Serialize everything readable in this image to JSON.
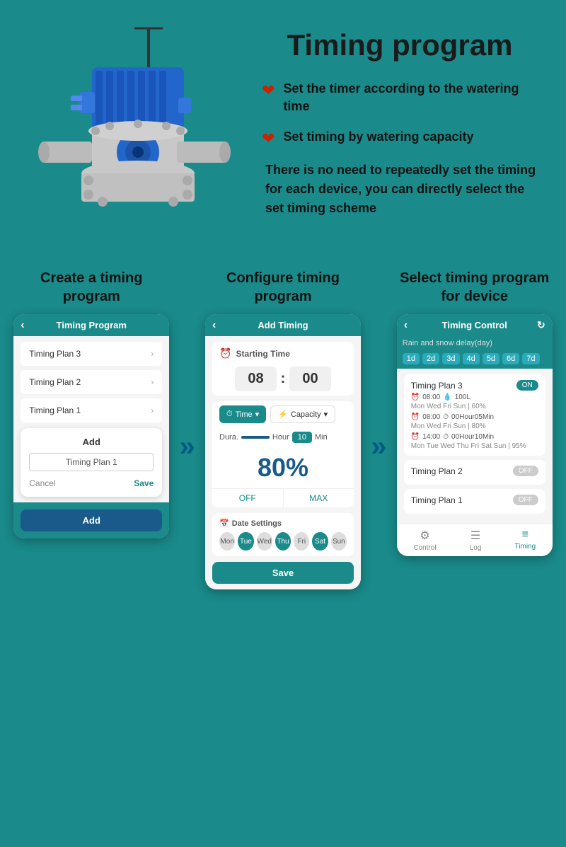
{
  "page": {
    "title": "Timing program",
    "background_color": "#1a8a8a"
  },
  "features": [
    {
      "icon": "❤",
      "text": "Set the timer according to the watering time"
    },
    {
      "icon": "❤",
      "text": "Set timing by watering capacity"
    }
  ],
  "description": "There is no need to repeatedly set the timing for each device, you can directly select the set timing scheme",
  "steps": [
    {
      "title": "Create a timing program",
      "screen": "timing-program"
    },
    {
      "title": "Configure timing program",
      "screen": "add-timing"
    },
    {
      "title": "Select timing program for device",
      "screen": "timing-control"
    }
  ],
  "phone1": {
    "header": "Timing Program",
    "plans": [
      "Timing Plan 3",
      "Timing Plan 2",
      "Timing Plan 1"
    ],
    "dialog": {
      "title": "Add",
      "input_value": "Timing Plan 1",
      "cancel_label": "Cancel",
      "save_label": "Save"
    },
    "footer_btn": "Add"
  },
  "phone2": {
    "header": "Add Timing",
    "starting_time_label": "Starting Time",
    "hour": "08",
    "minute": "00",
    "time_selector": "Time",
    "capacity_selector": "Capacity",
    "duration_label": "Dura.",
    "duration_hour": "Hour",
    "duration_min": "10",
    "duration_min_label": "Min",
    "percent": "80%",
    "off_label": "OFF",
    "max_label": "MAX",
    "date_settings_label": "Date Settings",
    "days": [
      {
        "label": "Mon",
        "active": false
      },
      {
        "label": "Tue",
        "active": true
      },
      {
        "label": "Wed",
        "active": false
      },
      {
        "label": "Thu",
        "active": true
      },
      {
        "label": "Fri",
        "active": false
      },
      {
        "label": "Sat",
        "active": true
      },
      {
        "label": "Sun",
        "active": false
      }
    ],
    "save_label": "Save"
  },
  "phone3": {
    "header": "Timing Control",
    "rain_delay_label": "Rain and snow delay(day)",
    "delay_days": [
      "1d",
      "2d",
      "3d",
      "4d",
      "5d",
      "6d",
      "7d"
    ],
    "plans": [
      {
        "name": "Timing Plan 3",
        "toggle": "ON",
        "entries": [
          {
            "time": "08:00",
            "volume": "100L",
            "schedule": "Mon Wed Fri Sun | 60%"
          },
          {
            "time": "08:00",
            "volume": "00Hour05Min",
            "schedule": "Mon Wed Fri Sun | 80%"
          },
          {
            "time": "14:00",
            "volume": "00Hour10Min",
            "schedule": "Mon Tue Wed Thu Fri Sat Sun | 95%"
          }
        ]
      },
      {
        "name": "Timing Plan 2",
        "toggle": "OFF"
      },
      {
        "name": "Timing Plan 1",
        "toggle": "OFF"
      }
    ],
    "footer_tabs": [
      {
        "label": "Control",
        "icon": "⚙",
        "active": false
      },
      {
        "label": "Log",
        "icon": "☰",
        "active": false
      },
      {
        "label": "Timing",
        "icon": "≡",
        "active": true
      }
    ]
  }
}
